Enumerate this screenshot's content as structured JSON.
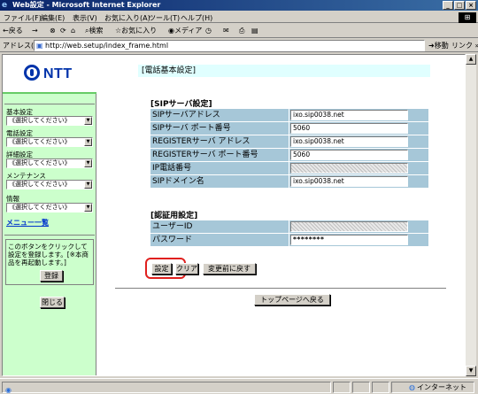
{
  "window": {
    "title": "Web設定 - Microsoft Internet Explorer",
    "controls": [
      "_",
      "□",
      "×"
    ]
  },
  "menubar": {
    "items": [
      "ファイル(F)",
      "編集(E)",
      "表示(V)",
      "お気に入り(A)",
      "ツール(T)",
      "ヘルプ(H)"
    ]
  },
  "toolbar": {
    "back": "←戻る",
    "forward": "→",
    "stop": "⊗",
    "refresh": "⟳",
    "home": "⌂",
    "search": "検索",
    "favorites": "お気に入り",
    "media": "メディア",
    "history": "◷",
    "mail": "✉",
    "print": "⎙",
    "edit": "▤"
  },
  "addressbar": {
    "label": "アドレス(D)",
    "url": "http://web.setup/index_frame.html",
    "go": "移動",
    "links": "リンク »"
  },
  "sidebar": {
    "logo": "NTT",
    "groups": [
      {
        "label": "基本設定",
        "selected": "《選択してください》"
      },
      {
        "label": "電話設定",
        "selected": "《選択してください》"
      },
      {
        "label": "詳細設定",
        "selected": "《選択してください》"
      },
      {
        "label": "メンテナンス",
        "selected": "《選択してください》"
      },
      {
        "label": "情報",
        "selected": "《選択してください》"
      }
    ],
    "menu_list_link": "メニュー一覧",
    "note": "このボタンをクリックして設定を登録します。[※本商品を再起動します。]",
    "register_button": "登録",
    "close_button": "閉じる"
  },
  "main": {
    "page_title": "[電話基本設定]",
    "sip_section": {
      "title": "[SIPサーバ設定]",
      "rows": [
        {
          "label": "SIPサーバアドレス",
          "value": "ixo.sip0038.net"
        },
        {
          "label": "SIPサーバ ポート番号",
          "value": "5060"
        },
        {
          "label": "REGISTERサーバ アドレス",
          "value": "ixo.sip0038.net"
        },
        {
          "label": "REGISTERサーバ ポート番号",
          "value": "5060"
        },
        {
          "label": "IP電話番号",
          "value": ""
        },
        {
          "label": "SIPドメイン名",
          "value": "ixo.sip0038.net"
        }
      ]
    },
    "auth_section": {
      "title": "[認証用設定]",
      "rows": [
        {
          "label": "ユーザーID",
          "value": ""
        },
        {
          "label": "パスワード",
          "value": "********"
        }
      ]
    },
    "buttons": {
      "set": "設定",
      "clear": "クリア",
      "revert": "変更前に戻す",
      "top_page": "トップページへ戻る"
    }
  },
  "statusbar": {
    "zone": "インターネット"
  },
  "colors": {
    "label_cell": "#a6c7d8",
    "sidebar_bg": "#ccffcc",
    "title_bar_bg": "#e0ffff",
    "highlight_ring": "#e0201e",
    "logo_blue": "#0033aa"
  }
}
